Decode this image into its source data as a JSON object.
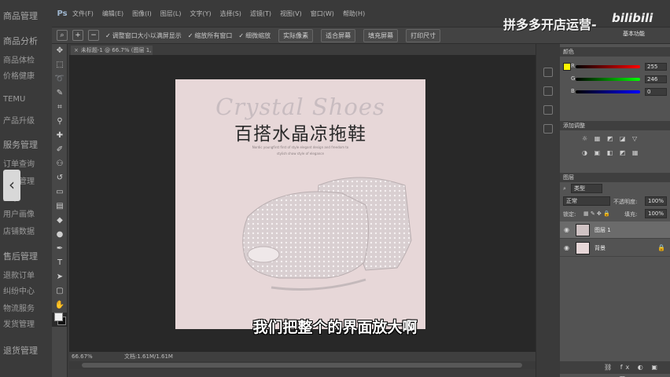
{
  "background_app": {
    "items": [
      "商品管理",
      "商品分析",
      "商品体检",
      "价格健康",
      "TEMU",
      "产品升级",
      "服务管理",
      "订单查询",
      "售后管理",
      "工单",
      "用户画像",
      "店铺数据",
      "售后管理",
      "退款订单",
      "纠纷中心",
      "物流服务",
      "发货管理",
      "退货管理"
    ],
    "back_icon": "chevron-left-icon"
  },
  "photoshop": {
    "logo": "Ps",
    "menu": [
      "文件(F)",
      "编辑(E)",
      "图像(I)",
      "图层(L)",
      "文字(Y)",
      "选择(S)",
      "滤镜(T)",
      "视图(V)",
      "窗口(W)",
      "帮助(H)"
    ],
    "options": {
      "zoom_tool_icon": "zoom-icon",
      "resize_windows": "调整窗口大小以满屏显示",
      "zoom_all_windows": "缩放所有窗口",
      "scrubby_zoom": "细微缩放",
      "actual_pixels": "实际像素",
      "fit_screen": "适合屏幕",
      "fill_screen": "填充屏幕",
      "print_size": "打印尺寸"
    },
    "tools": [
      "move-icon",
      "marquee-icon",
      "lasso-icon",
      "quick-select-icon",
      "crop-icon",
      "eyedropper-icon",
      "heal-icon",
      "brush-icon",
      "stamp-icon",
      "history-brush-icon",
      "eraser-icon",
      "gradient-icon",
      "blur-icon",
      "dodge-icon",
      "pen-icon",
      "type-icon",
      "path-select-icon",
      "shape-icon",
      "hand-icon",
      "zoom-icon"
    ],
    "doc_tab": "未标题-1 @ 66.7% (图层 1, RGB/8)",
    "status": {
      "zoom": "66.67%",
      "doc_size": "文档:1.61M/1.61M"
    }
  },
  "document": {
    "title_en": "Crystal Shoes",
    "title_cn": "百搭水晶凉拖鞋",
    "fine_line_1": "Nordic youngfirst first of style elegant design and freedom to",
    "fine_line_2": "stylish show style of elegance"
  },
  "color_panel": {
    "title": "颜色",
    "channels": [
      {
        "label": "R",
        "value": "255"
      },
      {
        "label": "G",
        "value": "246"
      },
      {
        "label": "B",
        "value": "0"
      }
    ],
    "swatch": "#fff600"
  },
  "adjustments_panel": {
    "title": "添加调整",
    "row1": "☼ ▦ ◩ ◪ ▽",
    "row2": "◑ ▣ ◧ ◩ ▦"
  },
  "layers_panel": {
    "title": "图层",
    "filter": "类型",
    "blend_mode": "正常",
    "opacity_label": "不透明度:",
    "opacity_value": "100%",
    "lock_label": "锁定:",
    "fill_label": "填充:",
    "fill_value": "100%",
    "layers": [
      {
        "name": "图层 1",
        "thumb": "#cfc2c3",
        "selected": true
      },
      {
        "name": "背景",
        "thumb": "#e7d7d8",
        "selected": false
      }
    ],
    "footer": "⛓ fx ◐ ▣ ▢ 🗑"
  },
  "overlay": {
    "brand": "拼多多开店运营-",
    "bilibili": "bilibili",
    "bilibili_sub": "基本功能",
    "subtitle": "我们把整个的界面放大啊"
  },
  "colors": {
    "doc_bg": "#e7d7d8",
    "accent": "#9fb7d0"
  }
}
